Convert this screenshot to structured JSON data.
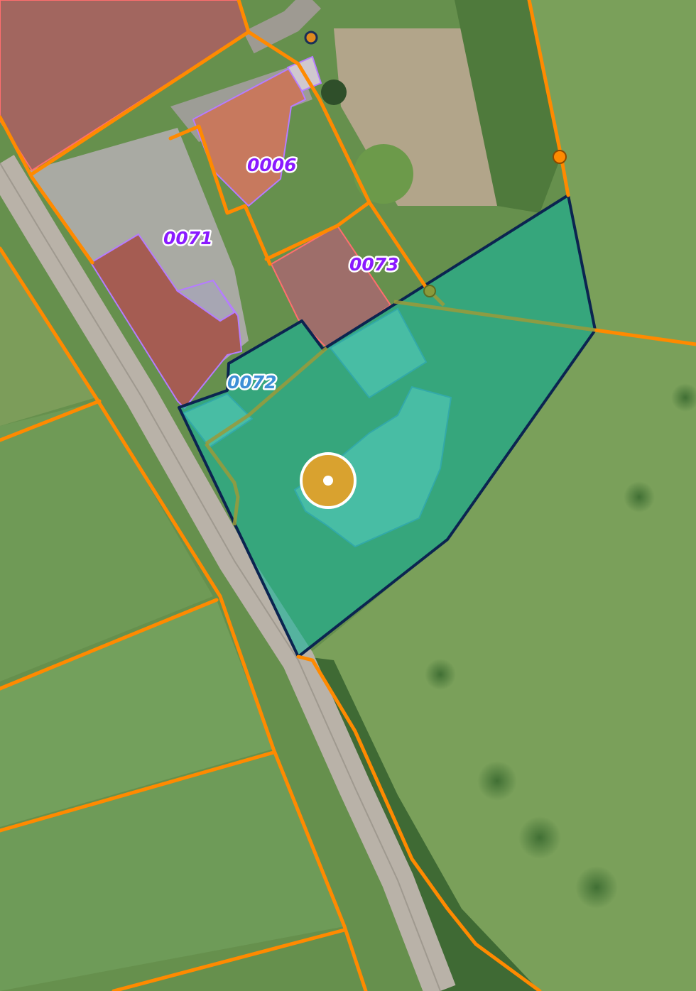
{
  "map": {
    "parcel_labels": [
      {
        "id": "0006",
        "text": "0006",
        "color": "#8a1aff"
      },
      {
        "id": "0071",
        "text": "0071",
        "color": "#8a1aff"
      },
      {
        "id": "0073",
        "text": "0073",
        "color": "#8a1aff"
      },
      {
        "id": "0072",
        "text": "0072",
        "color": "#3d8fd6"
      }
    ],
    "colors": {
      "parcel_boundary": "#ff8a00",
      "building_outline": "#b57cff",
      "selected_parcel_fill": "#19b39a",
      "selected_parcel_outline": "#0b2450",
      "location_marker": "#d9a22f",
      "road": "#b9b2a8",
      "roof": "#a2665f"
    },
    "icons": {
      "location_marker": "location-target-icon",
      "boundary_vertex": "boundary-vertex-icon"
    }
  }
}
